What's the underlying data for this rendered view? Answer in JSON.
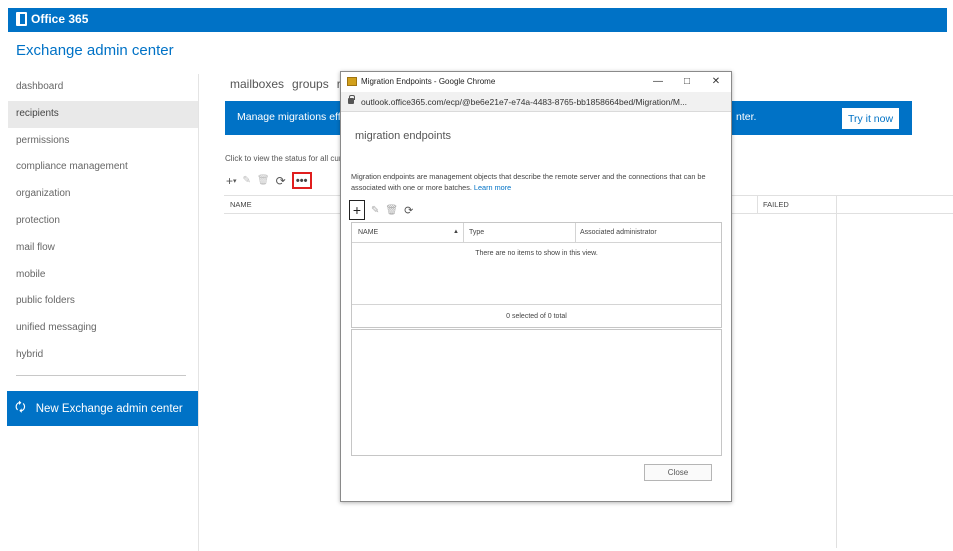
{
  "brand": {
    "suite_name": "Office 365",
    "app_title": "Exchange admin center"
  },
  "nav": {
    "items": [
      {
        "label": "dashboard",
        "active": false
      },
      {
        "label": "recipients",
        "active": true
      },
      {
        "label": "permissions",
        "active": false
      },
      {
        "label": "compliance management",
        "active": false
      },
      {
        "label": "organization",
        "active": false
      },
      {
        "label": "protection",
        "active": false
      },
      {
        "label": "mail flow",
        "active": false
      },
      {
        "label": "mobile",
        "active": false
      },
      {
        "label": "public folders",
        "active": false
      },
      {
        "label": "unified messaging",
        "active": false
      },
      {
        "label": "hybrid",
        "active": false
      }
    ],
    "new_eac": {
      "label": "New Exchange admin center",
      "icon": "exchange-icon"
    }
  },
  "main": {
    "tabs": [
      "mailboxes",
      "groups",
      "re"
    ],
    "banner": {
      "text_start": "Manage migrations effic",
      "text_end": "nter.",
      "button": "Try it now"
    },
    "status_hint": "Click to view the status for all cur",
    "toolbar": {
      "icons": [
        "add-icon",
        "edit-icon",
        "delete-icon",
        "refresh-icon",
        "more-icon"
      ],
      "more_label": "•••"
    },
    "columns": {
      "name": "NAME",
      "failed": "FAILED"
    }
  },
  "modal": {
    "window_title": "Migration Endpoints - Google Chrome",
    "url": "outlook.office365.com/ecp/@be6e21e7-e74a-4483-8765-bb1858664bed/Migration/M...",
    "heading": "migration endpoints",
    "description": "Migration endpoints are management objects that describe the remote server and the connections that can be associated with one or more batches.",
    "learn_more": "Learn more",
    "columns": [
      "NAME",
      "Type",
      "Associated administrator"
    ],
    "empty_text": "There are no items to show in this view.",
    "selection_text": "0 selected of 0 total",
    "close_label": "Close"
  },
  "colors": {
    "accent": "#0072c6",
    "highlight": "#e01e1e"
  }
}
